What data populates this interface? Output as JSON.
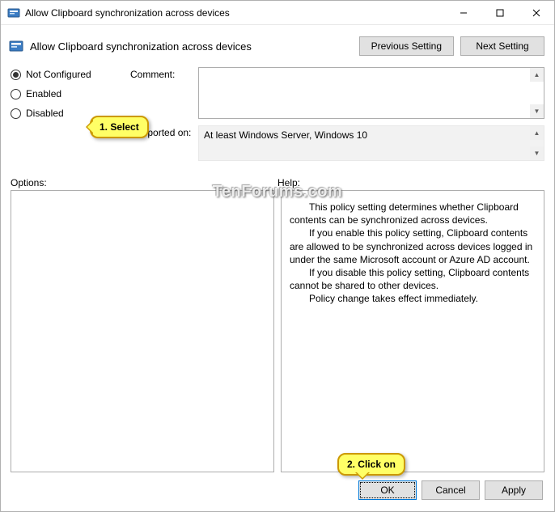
{
  "titlebar": {
    "title": "Allow Clipboard synchronization across devices"
  },
  "header": {
    "title": "Allow Clipboard synchronization across devices",
    "prev_btn": "Previous Setting",
    "next_btn": "Next Setting"
  },
  "radios": {
    "not_configured": "Not Configured",
    "enabled": "Enabled",
    "disabled": "Disabled"
  },
  "fields": {
    "comment_label": "Comment:",
    "supported_label": "Supported on:",
    "supported_value": "At least Windows Server, Windows 10"
  },
  "labels": {
    "options": "Options:",
    "help": "Help:"
  },
  "help": {
    "p1": "This policy setting determines whether Clipboard contents can be synchronized across devices.",
    "p2": "If you enable this policy setting, Clipboard contents are allowed to be synchronized across devices logged in under the same Microsoft account or Azure AD account.",
    "p3": "If you disable this policy setting, Clipboard contents cannot be shared to other devices.",
    "p4": "Policy change takes effect immediately."
  },
  "footer": {
    "ok": "OK",
    "cancel": "Cancel",
    "apply": "Apply"
  },
  "callouts": {
    "c1": "1. Select",
    "c2": "2. Click on"
  },
  "watermark": "TenForums.com"
}
